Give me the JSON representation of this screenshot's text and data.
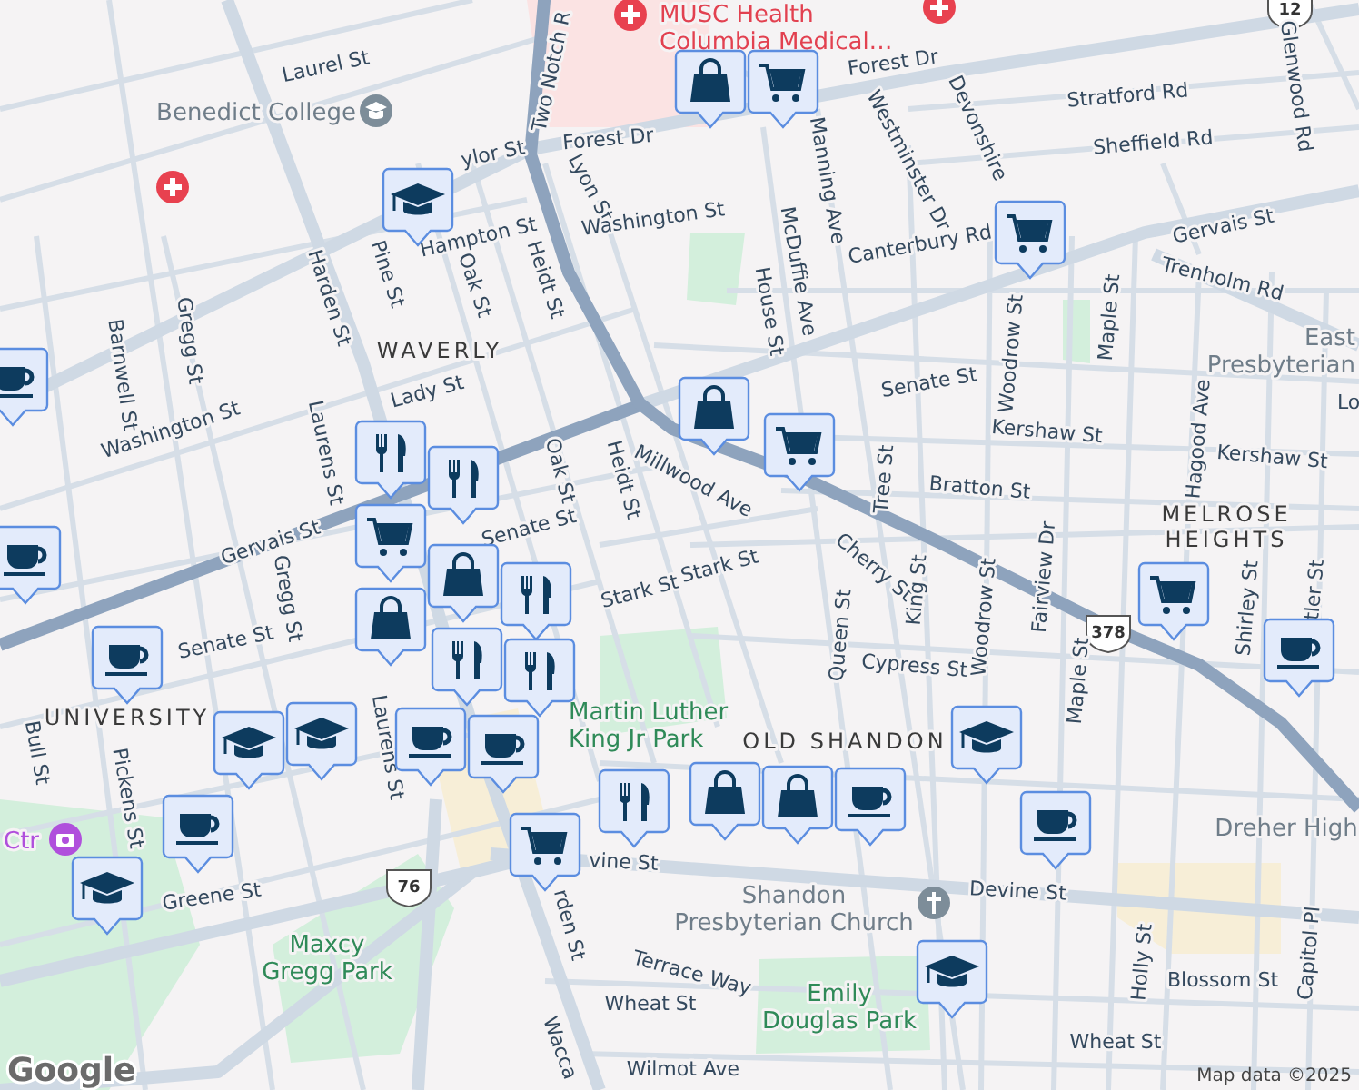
{
  "map": {
    "labels": [
      {
        "text": "Laurel St",
        "kind": "street"
      },
      {
        "text": "Benedict College",
        "kind": "poi"
      },
      {
        "text": "Two Notch R",
        "kind": "street"
      },
      {
        "lines": [
          "MUSC Health",
          "Columbia Medical…"
        ],
        "kind": "hospital"
      },
      {
        "text": "Forest Dr",
        "kind": "street"
      },
      {
        "text": "Forest Dr",
        "kind": "street"
      },
      {
        "text": "ylor St",
        "kind": "street"
      },
      {
        "text": "Lyon St",
        "kind": "street"
      },
      {
        "text": "Washington St",
        "kind": "street"
      },
      {
        "text": "Hampton St",
        "kind": "street"
      },
      {
        "text": "Pine St",
        "kind": "street"
      },
      {
        "text": "Oak St",
        "kind": "street"
      },
      {
        "text": "Heidt St",
        "kind": "street"
      },
      {
        "text": "WAVERLY",
        "kind": "area"
      },
      {
        "text": "Harden St",
        "kind": "street"
      },
      {
        "text": "Gregg St",
        "kind": "street"
      },
      {
        "text": "Barnwell St",
        "kind": "street"
      },
      {
        "text": "Washington St",
        "kind": "street"
      },
      {
        "text": "Lady St",
        "kind": "street"
      },
      {
        "text": "Laurens St",
        "kind": "street"
      },
      {
        "text": "Gervais St",
        "kind": "street"
      },
      {
        "text": "Senate St",
        "kind": "street"
      },
      {
        "text": "Oak St",
        "kind": "street"
      },
      {
        "text": "Heidt St",
        "kind": "street"
      },
      {
        "text": "Manning Ave",
        "kind": "street"
      },
      {
        "text": "McDuffie Ave",
        "kind": "street"
      },
      {
        "text": "House St",
        "kind": "street"
      },
      {
        "text": "Westminster Dr",
        "kind": "street"
      },
      {
        "text": "Devonshire",
        "kind": "street"
      },
      {
        "text": "Stratford Rd",
        "kind": "street"
      },
      {
        "text": "Sheffield Rd",
        "kind": "street"
      },
      {
        "text": "Glenwood Rd",
        "kind": "street"
      },
      {
        "text": "Canterbury Rd",
        "kind": "street"
      },
      {
        "text": "Gervais St",
        "kind": "street"
      },
      {
        "text": "Trenholm Rd",
        "kind": "street"
      },
      {
        "text": "Woodrow St",
        "kind": "street"
      },
      {
        "text": "Maple St",
        "kind": "street"
      },
      {
        "lines": [
          "East",
          "Presbyterian"
        ],
        "kind": "poi"
      },
      {
        "text": "Senate St",
        "kind": "street"
      },
      {
        "text": "Kershaw St",
        "kind": "street"
      },
      {
        "text": "Kershaw St",
        "kind": "street"
      },
      {
        "text": "Hagood Ave",
        "kind": "street"
      },
      {
        "text": "Lo",
        "kind": "street"
      },
      {
        "text": "Tree St",
        "kind": "street"
      },
      {
        "text": "Bratton St",
        "kind": "street"
      },
      {
        "text": "Fairview Dr",
        "kind": "street"
      },
      {
        "lines": [
          "MELROSE",
          "HEIGHTS"
        ],
        "kind": "area"
      },
      {
        "text": "Millwood Ave",
        "kind": "street"
      },
      {
        "text": "Cherry St",
        "kind": "street"
      },
      {
        "text": "Stark St",
        "kind": "street"
      },
      {
        "text": "Stark St",
        "kind": "street"
      },
      {
        "text": "King St",
        "kind": "street"
      },
      {
        "text": "Queen St",
        "kind": "street"
      },
      {
        "text": "Woodrow St",
        "kind": "street"
      },
      {
        "text": "Maple St",
        "kind": "street"
      },
      {
        "text": "Shirley St",
        "kind": "street"
      },
      {
        "text": "tler St",
        "kind": "street"
      },
      {
        "text": "Cypress St",
        "kind": "street"
      },
      {
        "lines": [
          "Martin Luther",
          "King Jr Park"
        ],
        "kind": "park"
      },
      {
        "text": "OLD SHANDON",
        "kind": "area"
      },
      {
        "text": "UNIVERSITY",
        "kind": "area"
      },
      {
        "text": "Senate St",
        "kind": "street"
      },
      {
        "text": "Gregg St",
        "kind": "street"
      },
      {
        "text": "Pickens St",
        "kind": "street"
      },
      {
        "text": "Bull St",
        "kind": "street"
      },
      {
        "text": "Laurens St",
        "kind": "street"
      },
      {
        "text": "Ctr",
        "kind": "venue"
      },
      {
        "text": "Greene St",
        "kind": "street"
      },
      {
        "lines": [
          "Maxcy",
          "Gregg Park"
        ],
        "kind": "park"
      },
      {
        "text": "vine St",
        "kind": "street"
      },
      {
        "text": "Devine St",
        "kind": "street"
      },
      {
        "text": "rden St",
        "kind": "street"
      },
      {
        "lines": [
          "Shandon",
          "Presbyterian Church"
        ],
        "kind": "poi"
      },
      {
        "text": "Terrace Way",
        "kind": "street"
      },
      {
        "text": "Blossom St",
        "kind": "street"
      },
      {
        "text": "Holly St",
        "kind": "street"
      },
      {
        "text": "Capitol Pl",
        "kind": "street"
      },
      {
        "text": "Wheat St",
        "kind": "street"
      },
      {
        "text": "Wheat St",
        "kind": "street"
      },
      {
        "lines": [
          "Emily",
          "Douglas Park"
        ],
        "kind": "park"
      },
      {
        "text": "Wilmot Ave",
        "kind": "street"
      },
      {
        "text": "Wacca",
        "kind": "street"
      },
      {
        "text": "Dreher High",
        "kind": "poi"
      }
    ],
    "route_shields": [
      "378",
      "76",
      "12"
    ],
    "attribution": "Map data ©2025",
    "logo": "Google"
  }
}
